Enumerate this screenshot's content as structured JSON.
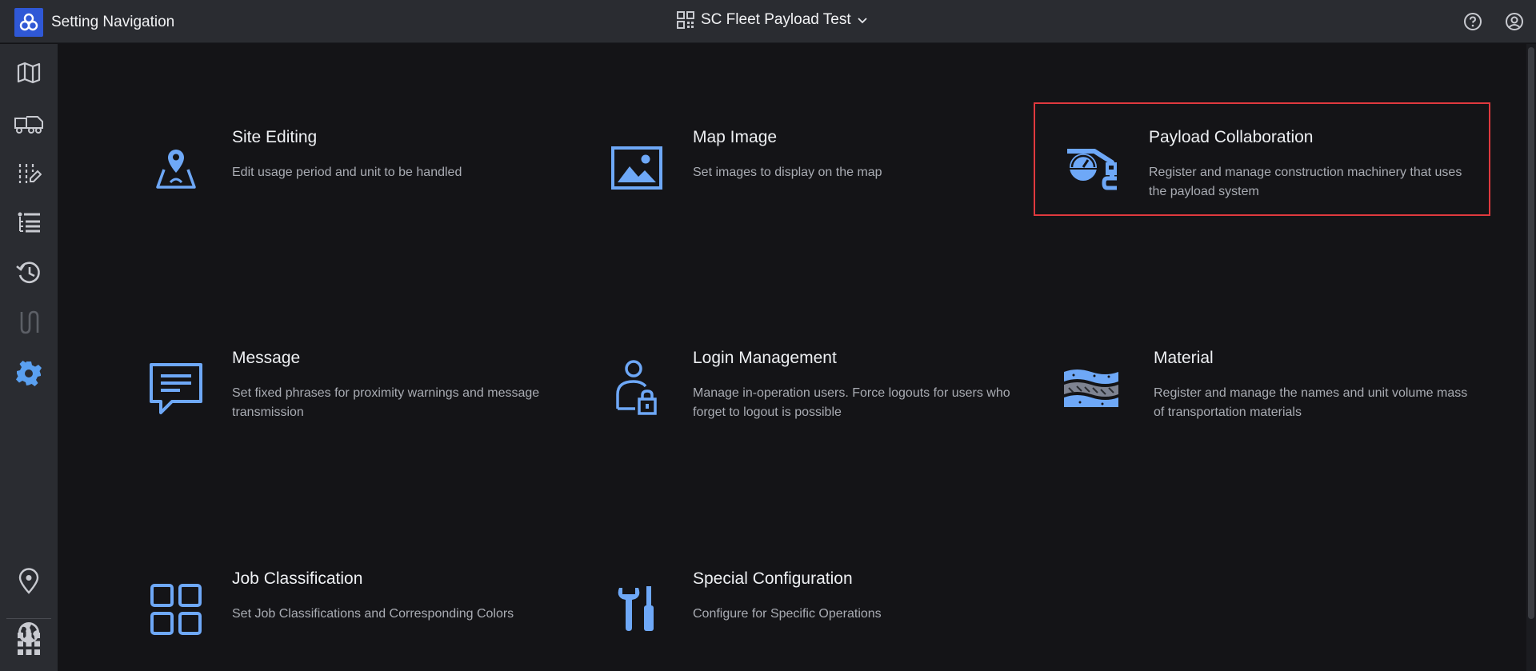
{
  "header": {
    "app_title": "Setting Navigation",
    "project_name": "SC Fleet Payload Test",
    "icons": [
      "app-logo-icon",
      "qr-grid-icon",
      "chevron-down-icon",
      "help-icon",
      "account-icon"
    ]
  },
  "sidebar": {
    "items": [
      {
        "name": "map-icon"
      },
      {
        "name": "truck-icon"
      },
      {
        "name": "edit-settings-icon"
      },
      {
        "name": "list-icon"
      },
      {
        "name": "history-icon"
      },
      {
        "name": "route-icon"
      },
      {
        "name": "settings-icon",
        "active": true
      },
      {
        "name": "location-pin-icon"
      },
      {
        "name": "globe-icon"
      },
      {
        "name": "apps-grid-icon"
      }
    ]
  },
  "cards": [
    {
      "title": "Site Editing",
      "description": "Edit usage period and unit to be handled",
      "icon": "site-editing-icon"
    },
    {
      "title": "Map Image",
      "description": "Set images to display on the map",
      "icon": "image-icon"
    },
    {
      "title": "Payload Collaboration",
      "description": "Register and manage construction machinery that uses the payload system",
      "icon": "excavator-payload-icon",
      "highlighted": true
    },
    {
      "title": "Message",
      "description": "Set fixed phrases for proximity warnings and message transmission",
      "icon": "message-icon"
    },
    {
      "title": "Login Management",
      "description": "Manage in-operation users. Force logouts for users who forget to logout is possible",
      "icon": "user-lock-icon"
    },
    {
      "title": "Material",
      "description": "Register and manage the names and unit volume mass of transportation materials",
      "icon": "material-layers-icon"
    },
    {
      "title": "Job Classification",
      "description": "Set Job Classifications and Corresponding Colors",
      "icon": "grid-squares-icon"
    },
    {
      "title": "Special Configuration",
      "description": "Configure for Specific Operations",
      "icon": "tools-icon"
    }
  ],
  "colors": {
    "accent": "#6ea8f7",
    "highlight_border": "#e0393e",
    "active_nav": "#5aa0f0",
    "sidebar_icon": "#c8cad0"
  }
}
